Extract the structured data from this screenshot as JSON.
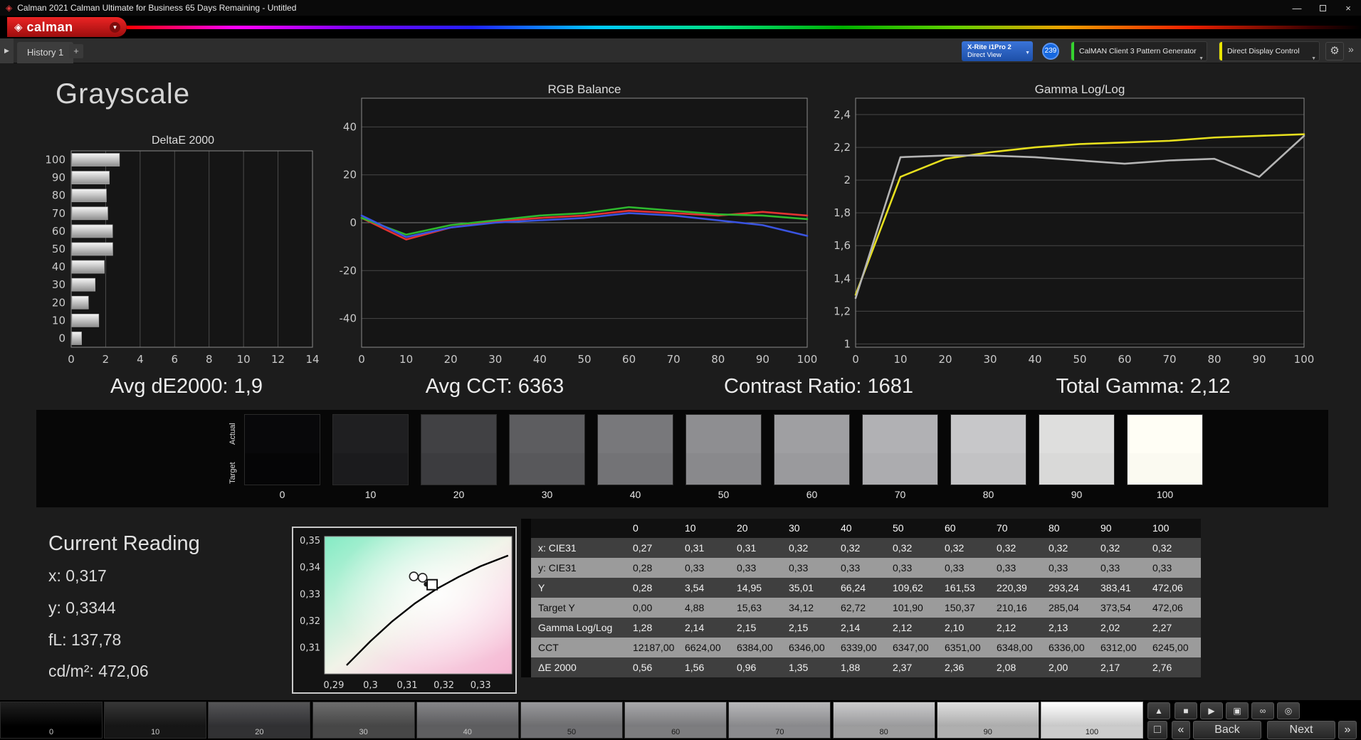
{
  "window": {
    "title": "Calman 2021 Calman Ultimate for Business 65 Days Remaining  - Untitled",
    "brand": "calman"
  },
  "icons": {
    "brand_mark": "◈",
    "dropdown": "▼",
    "gear": "⚙",
    "nav_arrow": "▶",
    "expand": "»",
    "add_tab": "+",
    "minimize": "—",
    "close": "×"
  },
  "tabs": {
    "history": "History 1"
  },
  "devices": {
    "meter_line1": "X-Rite i1Pro 2",
    "meter_line2": "Direct View",
    "meter_badge": "239",
    "pattern_generator": "CalMAN Client 3 Pattern Generator",
    "display_control": "Direct Display Control",
    "pattern_generator_accent": "#35d22f",
    "display_control_accent": "#e8e400"
  },
  "page": {
    "title": "Grayscale"
  },
  "summary": {
    "de": "Avg dE2000: 1,9",
    "cct": "Avg CCT: 6363",
    "contrast": "Contrast Ratio: 1681",
    "gamma": "Total Gamma: 2,12"
  },
  "grayscale_strip": {
    "actual_label": "Actual",
    "target_label": "Target",
    "levels": [
      "0",
      "10",
      "20",
      "30",
      "40",
      "50",
      "60",
      "70",
      "80",
      "90",
      "100"
    ],
    "actual_colors": [
      "#08080a",
      "#1f1f21",
      "#414144",
      "#5d5d60",
      "#78787b",
      "#8e8e91",
      "#9f9fa2",
      "#b1b1b4",
      "#c7c7c9",
      "#dededd",
      "#fffef5"
    ],
    "target_colors": [
      "#050506",
      "#1b1b1d",
      "#3c3c3f",
      "#58585b",
      "#737376",
      "#89898c",
      "#9a9a9d",
      "#acacaf",
      "#c2c2c4",
      "#d9d9d8",
      "#fbfaf1"
    ]
  },
  "current_reading": {
    "title": "Current Reading",
    "lines": [
      "x: 0,317",
      "y: 0,3344",
      "fL: 137,78",
      "cd/m²: 472,06"
    ]
  },
  "table": {
    "columns": [
      "",
      "0",
      "10",
      "20",
      "30",
      "40",
      "50",
      "60",
      "70",
      "80",
      "90",
      "100"
    ],
    "rows": [
      {
        "label": "x: CIE31",
        "values": [
          "0,27",
          "0,31",
          "0,31",
          "0,32",
          "0,32",
          "0,32",
          "0,32",
          "0,32",
          "0,32",
          "0,32",
          "0,32"
        ]
      },
      {
        "label": "y: CIE31",
        "values": [
          "0,28",
          "0,33",
          "0,33",
          "0,33",
          "0,33",
          "0,33",
          "0,33",
          "0,33",
          "0,33",
          "0,33",
          "0,33"
        ]
      },
      {
        "label": "Y",
        "values": [
          "0,28",
          "3,54",
          "14,95",
          "35,01",
          "66,24",
          "109,62",
          "161,53",
          "220,39",
          "293,24",
          "383,41",
          "472,06"
        ]
      },
      {
        "label": "Target Y",
        "values": [
          "0,00",
          "4,88",
          "15,63",
          "34,12",
          "62,72",
          "101,90",
          "150,37",
          "210,16",
          "285,04",
          "373,54",
          "472,06"
        ]
      },
      {
        "label": "Gamma Log/Log",
        "values": [
          "1,28",
          "2,14",
          "2,15",
          "2,15",
          "2,14",
          "2,12",
          "2,10",
          "2,12",
          "2,13",
          "2,02",
          "2,27"
        ]
      },
      {
        "label": "CCT",
        "values": [
          "12187,00",
          "6624,00",
          "6384,00",
          "6346,00",
          "6339,00",
          "6347,00",
          "6351,00",
          "6348,00",
          "6336,00",
          "6312,00",
          "6245,00"
        ]
      },
      {
        "label": "ΔE 2000",
        "values": [
          "0,56",
          "1,56",
          "0,96",
          "1,35",
          "1,88",
          "2,37",
          "2,36",
          "2,08",
          "2,00",
          "2,17",
          "2,76"
        ]
      }
    ]
  },
  "pattern_bar": {
    "levels": [
      "0",
      "10",
      "20",
      "30",
      "40",
      "50",
      "60",
      "70",
      "80",
      "90",
      "100"
    ],
    "colors": [
      "#000000",
      "#1b1b1b",
      "#3d3d40",
      "#595959",
      "#757578",
      "#8b8b8e",
      "#9c9c9f",
      "#aeaeb1",
      "#c4c4c6",
      "#dbdbdb",
      "#ffffff"
    ],
    "selected_index": 10
  },
  "transport": {
    "eject": "▲",
    "stop": "■",
    "play": "▶",
    "capture": "▣",
    "loop": "∞",
    "record": "◎",
    "pattern_window": "□",
    "prev": "«",
    "back": "Back",
    "next": "Next",
    "forward": "»"
  },
  "chart_data": [
    {
      "id": "deltae",
      "type": "bar",
      "orientation": "horizontal",
      "title": "DeltaE 2000",
      "categories": [
        "0",
        "10",
        "20",
        "30",
        "40",
        "50",
        "60",
        "70",
        "80",
        "90",
        "100"
      ],
      "values": [
        0.56,
        1.56,
        0.96,
        1.35,
        1.88,
        2.37,
        2.36,
        2.08,
        2.0,
        2.17,
        2.76
      ],
      "xlim": [
        0,
        14
      ],
      "xticks": [
        0,
        2,
        4,
        6,
        8,
        10,
        12,
        14
      ],
      "bar_color": "#d9d9d9",
      "grid": true
    },
    {
      "id": "rgb",
      "type": "line",
      "title": "RGB Balance",
      "x": [
        0,
        10,
        20,
        30,
        40,
        50,
        60,
        70,
        80,
        90,
        100
      ],
      "xtick_labels": [
        "0",
        "10",
        "20",
        "30",
        "40",
        "50",
        "60",
        "70",
        "80",
        "90",
        "100"
      ],
      "ylim": [
        -52,
        52
      ],
      "yticks": [
        -40,
        -20,
        0,
        20,
        40
      ],
      "ytick_labels": [
        "-40",
        "-20",
        "0",
        "20",
        "40"
      ],
      "grid": true,
      "series": [
        {
          "name": "Red",
          "color": "#e23232",
          "values": [
            2,
            -7,
            -2,
            0.5,
            2,
            3,
            5,
            4,
            3,
            4.5,
            3
          ]
        },
        {
          "name": "Green",
          "color": "#2eb82e",
          "values": [
            2,
            -5,
            -1,
            1,
            3,
            4,
            6.5,
            5,
            3.5,
            3,
            1.5
          ]
        },
        {
          "name": "Blue",
          "color": "#3a54e0",
          "values": [
            3,
            -6,
            -2,
            0,
            1,
            2,
            4,
            3,
            1,
            -1,
            -5.5
          ]
        }
      ]
    },
    {
      "id": "gamma",
      "type": "line",
      "title": "Gamma Log/Log",
      "x": [
        0,
        10,
        20,
        30,
        40,
        50,
        60,
        70,
        80,
        90,
        100
      ],
      "xtick_labels": [
        "0",
        "10",
        "20",
        "30",
        "40",
        "50",
        "60",
        "70",
        "80",
        "90",
        "100"
      ],
      "ylim": [
        0.98,
        2.5
      ],
      "yticks": [
        1,
        1.2,
        1.4,
        1.6,
        1.8,
        2,
        2.2,
        2.4
      ],
      "ytick_labels": [
        "1",
        "1,2",
        "1,4",
        "1,6",
        "1,8",
        "2",
        "2,2",
        "2,4"
      ],
      "grid": true,
      "series": [
        {
          "name": "Target Gamma",
          "color": "#e6df1e",
          "values": [
            1.3,
            2.02,
            2.13,
            2.17,
            2.2,
            2.22,
            2.23,
            2.24,
            2.26,
            2.27,
            2.28
          ]
        },
        {
          "name": "Measured Gamma",
          "color": "#b4b4b4",
          "values": [
            1.28,
            2.14,
            2.15,
            2.15,
            2.14,
            2.12,
            2.1,
            2.12,
            2.13,
            2.02,
            2.27
          ]
        }
      ]
    },
    {
      "id": "cie",
      "type": "scatter",
      "title": "CIE 1931 Chromaticity",
      "xlim": [
        0.2875,
        0.3385
      ],
      "ylim": [
        0.3003,
        0.3516
      ],
      "xticks": [
        0.29,
        0.3,
        0.31,
        0.32,
        0.33
      ],
      "xtick_labels": [
        "0,29",
        "0,3",
        "0,31",
        "0,32",
        "0,33"
      ],
      "yticks": [
        0.31,
        0.32,
        0.33,
        0.34,
        0.35
      ],
      "ytick_labels": [
        "0,31",
        "0,32",
        "0,33",
        "0,34",
        "0,35"
      ],
      "locus": [
        [
          0.2935,
          0.3035
        ],
        [
          0.3,
          0.3125
        ],
        [
          0.306,
          0.32
        ],
        [
          0.312,
          0.3265
        ],
        [
          0.318,
          0.332
        ],
        [
          0.324,
          0.3365
        ],
        [
          0.33,
          0.3405
        ],
        [
          0.3375,
          0.3445
        ]
      ],
      "markers": [
        {
          "shape": "circle",
          "x": 0.3118,
          "y": 0.3367
        },
        {
          "shape": "circle",
          "x": 0.3142,
          "y": 0.3362
        },
        {
          "shape": "dot",
          "x": 0.3152,
          "y": 0.3338
        },
        {
          "shape": "square",
          "x": 0.3168,
          "y": 0.3336
        }
      ]
    }
  ]
}
